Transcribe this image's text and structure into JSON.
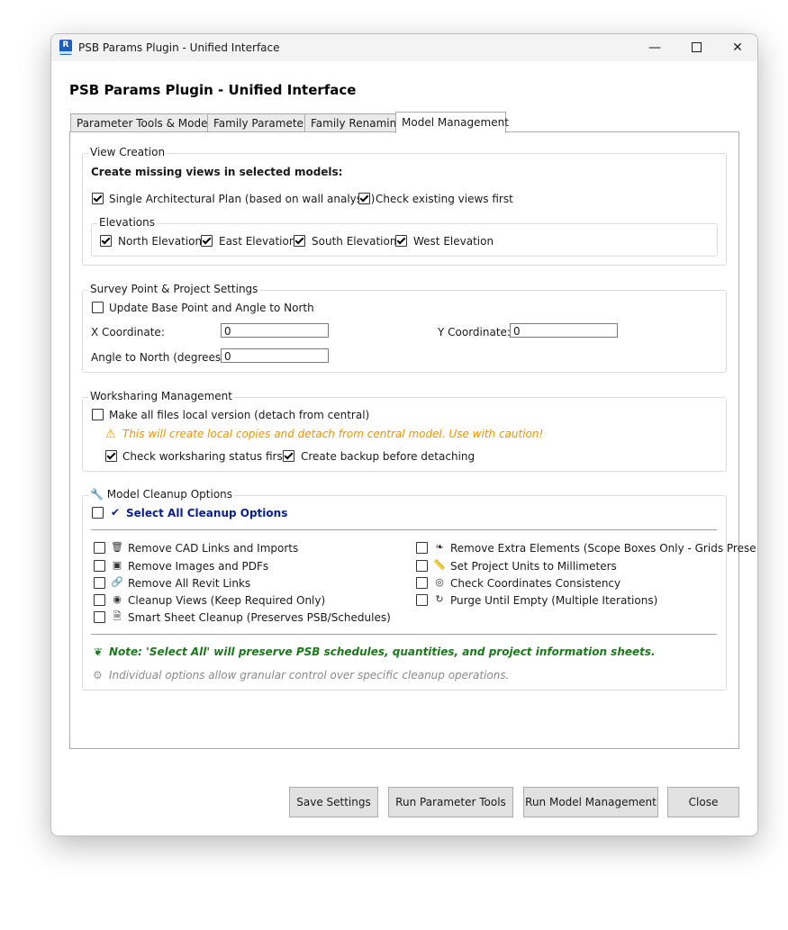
{
  "window": {
    "title": "PSB Params Plugin - Unified Interface",
    "icon_name": "revit-app-icon",
    "icon_letter": "R",
    "controls": [
      "minimize-icon",
      "maximize-icon",
      "close-icon"
    ]
  },
  "heading": "PSB Params Plugin - Unified Interface",
  "tabs": [
    {
      "label": "Parameter Tools & Models",
      "active": false
    },
    {
      "label": "Family Parameters",
      "active": false
    },
    {
      "label": "Family Renaming",
      "active": false
    },
    {
      "label": "Model Management",
      "active": true
    }
  ],
  "view_creation": {
    "title": "View Creation",
    "subtitle": "Create missing views in selected models:",
    "single_plan": {
      "label": "Single Architectural Plan (based on wall analysis)",
      "checked": true
    },
    "check_existing": {
      "label": "Check existing views first",
      "checked": true
    },
    "elevations": {
      "title": "Elevations",
      "items": [
        {
          "label": "North Elevation",
          "checked": true
        },
        {
          "label": "East Elevation",
          "checked": true
        },
        {
          "label": "South Elevation",
          "checked": true
        },
        {
          "label": "West Elevation",
          "checked": true
        }
      ]
    }
  },
  "survey": {
    "title": "Survey Point & Project Settings",
    "update_base": {
      "label": "Update Base Point and Angle to North",
      "checked": false
    },
    "x_label": "X Coordinate:",
    "x_value": "0",
    "y_label": "Y Coordinate:",
    "y_value": "0",
    "angle_label": "Angle to North (degrees):",
    "angle_value": "0"
  },
  "worksharing": {
    "title": "Worksharing Management",
    "make_local": {
      "label": "Make all files local version (detach from central)",
      "checked": false
    },
    "warning": "This will create local copies and detach from central model. Use with caution!",
    "warning_icon": "warning-icon",
    "warning_color": "#e69500",
    "check_status": {
      "label": "Check worksharing status first",
      "checked": true
    },
    "create_backup": {
      "label": "Create backup before detaching",
      "checked": true
    }
  },
  "cleanup": {
    "title": "Model Cleanup Options",
    "title_icon": "wrench-icon",
    "select_all": {
      "label": "Select All Cleanup Options",
      "checked": false,
      "color": "#0a1f8f"
    },
    "left_options": [
      {
        "icon": "trash-icon",
        "label": "Remove CAD Links and Imports",
        "checked": false
      },
      {
        "icon": "image-icon",
        "label": "Remove Images and PDFs",
        "checked": false
      },
      {
        "icon": "link-icon",
        "label": "Remove All Revit Links",
        "checked": false
      },
      {
        "icon": "eye-icon",
        "label": "Cleanup Views (Keep Required Only)",
        "checked": false
      },
      {
        "icon": "document-icon",
        "label": "Smart Sheet Cleanup (Preserves PSB/Schedules)",
        "checked": false
      }
    ],
    "right_options": [
      {
        "icon": "brush-icon",
        "label": "Remove Extra Elements (Scope Boxes Only - Grids Prese",
        "checked": false
      },
      {
        "icon": "ruler-icon",
        "label": "Set Project Units to Millimeters",
        "checked": false
      },
      {
        "icon": "target-icon",
        "label": "Check Coordinates Consistency",
        "checked": false
      },
      {
        "icon": "refresh-icon",
        "label": "Purge Until Empty (Multiple Iterations)",
        "checked": false
      }
    ],
    "note": "Note: 'Select All' will preserve PSB schedules, quantities, and project information sheets.",
    "note_icon": "leaf-icon",
    "note_color": "#1a7a1a",
    "info": "Individual options allow granular control over specific cleanup operations.",
    "info_icon": "gear-icon"
  },
  "buttons": {
    "save": "Save Settings",
    "run_params": "Run Parameter Tools",
    "run_model": "Run Model Management",
    "close": "Close"
  }
}
